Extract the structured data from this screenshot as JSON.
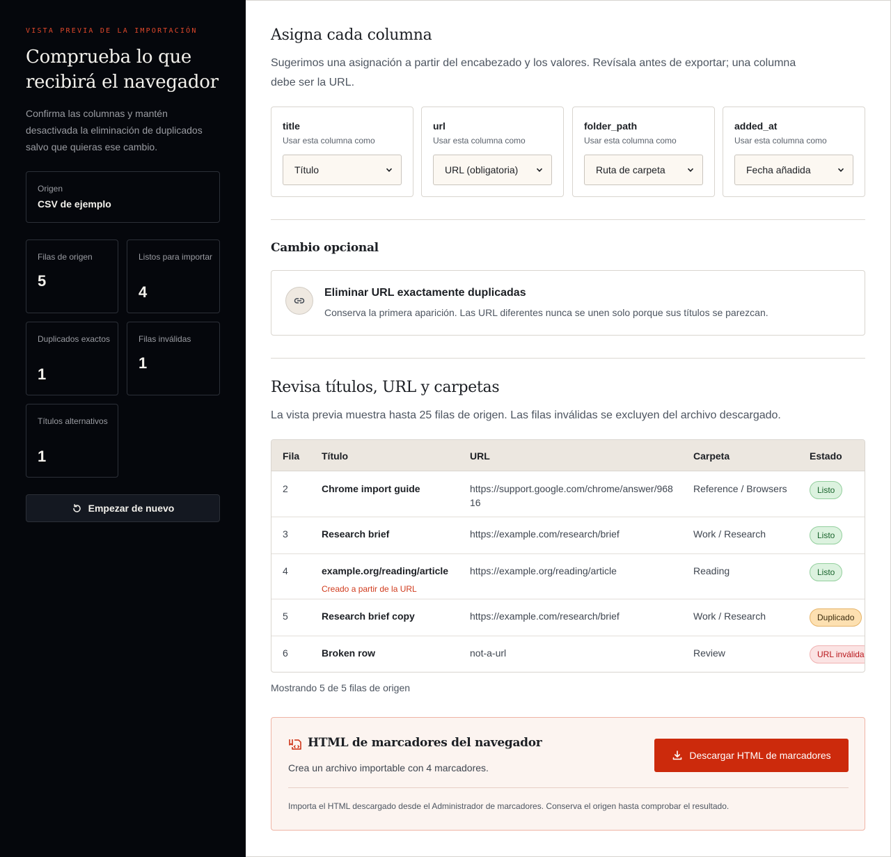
{
  "sidebar": {
    "eyebrow": "VISTA PREVIA DE LA IMPORTACIÓN",
    "title": "Comprueba lo que recibirá el navegador",
    "description": "Confirma las columnas y mantén desactivada la eliminación de duplicados salvo que quieras ese cambio.",
    "origin_label": "Origen",
    "origin_value": "CSV de ejemplo",
    "stats": [
      {
        "label": "Filas de origen",
        "value": "5"
      },
      {
        "label": "Listos para importar",
        "value": "4"
      },
      {
        "label": "Duplicados exactos",
        "value": "1"
      },
      {
        "label": "Filas inválidas",
        "value": "1"
      },
      {
        "label": "Títulos alternativos",
        "value": "1"
      }
    ],
    "restart_label": "Empezar de nuevo"
  },
  "mapping": {
    "title": "Asigna cada columna",
    "description": "Sugerimos una asignación a partir del encabezado y los valores. Revísala antes de exportar; una columna debe ser la URL.",
    "hint": "Usar esta columna como",
    "columns": [
      {
        "name": "title",
        "selected": "Título"
      },
      {
        "name": "url",
        "selected": "URL (obligatoria)"
      },
      {
        "name": "folder_path",
        "selected": "Ruta de carpeta"
      },
      {
        "name": "added_at",
        "selected": "Fecha añadida"
      }
    ]
  },
  "optional": {
    "title": "Cambio opcional",
    "option_title": "Eliminar URL exactamente duplicadas",
    "option_desc": "Conserva la primera aparición. Las URL diferentes nunca se unen solo porque sus títulos se parezcan."
  },
  "review": {
    "title": "Revisa títulos, URL y carpetas",
    "description": "La vista previa muestra hasta 25 filas de origen. Las filas inválidas se excluyen del archivo descargado.",
    "headers": {
      "row": "Fila",
      "title": "Título",
      "url": "URL",
      "folder": "Carpeta",
      "status": "Estado"
    },
    "rows": [
      {
        "row": "2",
        "title": "Chrome import guide",
        "subnote": "",
        "url": "https://support.google.com/chrome/answer/96816",
        "folder": "Reference / Browsers",
        "status": "Listo",
        "status_kind": "ok"
      },
      {
        "row": "3",
        "title": "Research brief",
        "subnote": "",
        "url": "https://example.com/research/brief",
        "folder": "Work / Research",
        "status": "Listo",
        "status_kind": "ok"
      },
      {
        "row": "4",
        "title": "example.org/reading/article",
        "subnote": "Creado a partir de la URL",
        "url": "https://example.org/reading/article",
        "folder": "Reading",
        "status": "Listo",
        "status_kind": "ok"
      },
      {
        "row": "5",
        "title": "Research brief copy",
        "subnote": "",
        "url": "https://example.com/research/brief",
        "folder": "Work / Research",
        "status": "Duplicado",
        "status_kind": "dup"
      },
      {
        "row": "6",
        "title": "Broken row",
        "subnote": "",
        "url": "not-a-url",
        "folder": "Review",
        "status": "URL inválida",
        "status_kind": "bad"
      }
    ],
    "showing": "Mostrando 5 de 5 filas de origen"
  },
  "export": {
    "title": "HTML de marcadores del navegador",
    "description": "Crea un archivo importable con 4 marcadores.",
    "button": "Descargar HTML de marcadores",
    "note": "Importa el HTML descargado desde el Administrador de marcadores. Conserva el origen hasta comprobar el resultado."
  },
  "colors": {
    "sidebar_bg": "#05070c",
    "accent": "#cc2a0c",
    "eyebrow": "#e0482b"
  },
  "icons": [
    "restart-icon",
    "link-icon",
    "bookmark-file-icon",
    "download-icon",
    "chevron-down-icon"
  ]
}
